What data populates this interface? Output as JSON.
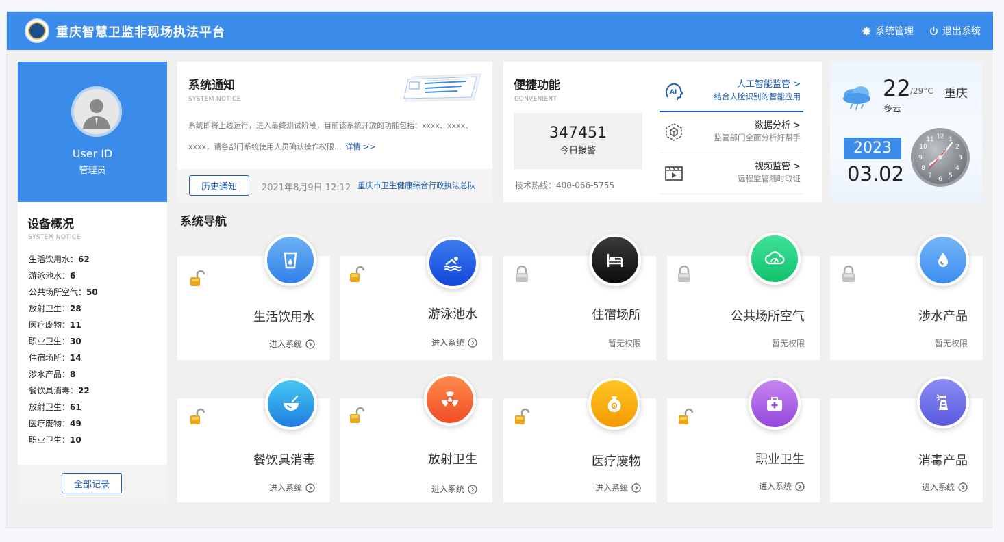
{
  "header": {
    "title": "重庆智慧卫监非现场执法平台",
    "settings_label": "系统管理",
    "logout_label": "退出系统"
  },
  "user": {
    "id": "User ID",
    "role": "管理员"
  },
  "devices": {
    "title": "设备概况",
    "subtitle": "SYSTEM NOTICE",
    "items": [
      {
        "label": "生活饮用水：",
        "value": "62"
      },
      {
        "label": "游泳池水：",
        "value": "6"
      },
      {
        "label": "公共场所空气：",
        "value": "50"
      },
      {
        "label": "放射卫生：",
        "value": "28"
      },
      {
        "label": "医疗废物：",
        "value": "11"
      },
      {
        "label": "职业卫生：",
        "value": "30"
      },
      {
        "label": "住宿场所：",
        "value": "14"
      },
      {
        "label": "涉水产品：",
        "value": "8"
      },
      {
        "label": "餐饮具消毒：",
        "value": "22"
      },
      {
        "label": "放射卫生：",
        "value": "61"
      },
      {
        "label": "医疗废物：",
        "value": "49"
      },
      {
        "label": "职业卫生：",
        "value": "10"
      }
    ],
    "all_records_label": "全部记录"
  },
  "notice": {
    "title": "系统通知",
    "subtitle": "SYSTEM NOTICE",
    "text": "系统即将上线运行，进入最终测试阶段，目前该系统开放的功能包括：xxxx、xxxx、xxxx，请各部门系统使用人员确认操作权限...",
    "more_label": "详情 >>",
    "history_label": "历史通知",
    "date": "2021年8月9日  12:12",
    "org": "重庆市卫生健康综合行政执法总队"
  },
  "quick": {
    "title": "便捷功能",
    "subtitle": "CONVENIENT",
    "alarm_count": "347451",
    "alarm_label": "今日报警",
    "hotline": "技术热线：400-066-5755",
    "items": [
      {
        "name": "人工智能监管 >",
        "desc": "结合人脸识别的智能应用",
        "icon": "ai-head-icon"
      },
      {
        "name": "数据分析 >",
        "desc": "监管部门全面分析好帮手",
        "icon": "data-cube-icon"
      },
      {
        "name": "视频监管 >",
        "desc": "远程监管随时取证",
        "icon": "video-icon"
      }
    ]
  },
  "weather": {
    "temp": "22",
    "range": "/29°C",
    "city": "重庆",
    "condition": "多云",
    "year": "2023",
    "month_day": "03.02",
    "icon": "cloud-rain-icon"
  },
  "nav": {
    "title": "系统导航",
    "cards": [
      {
        "name": "生活饮用水",
        "entry": "进入系统",
        "access": true,
        "color_a": "#6db2f5",
        "color_b": "#2f80e7",
        "icon": "water-cup-icon"
      },
      {
        "name": "游泳池水",
        "entry": "进入系统",
        "access": true,
        "color_a": "#3d7cf0",
        "color_b": "#1146d8",
        "icon": "swimmer-icon"
      },
      {
        "name": "住宿场所",
        "entry": "暂无权限",
        "access": false,
        "color_a": "#3a3a3a",
        "color_b": "#0d0d0d",
        "icon": "bed-icon"
      },
      {
        "name": "公共场所空气",
        "entry": "暂无权限",
        "access": false,
        "color_a": "#3fe29a",
        "color_b": "#11c26d",
        "icon": "air-gauge-icon"
      },
      {
        "name": "涉水产品",
        "entry": "暂无权限",
        "access": false,
        "color_a": "#74b6f8",
        "color_b": "#3d8def",
        "icon": "water-drop-icon"
      },
      {
        "name": "餐饮具消毒",
        "entry": "进入系统",
        "access": true,
        "color_a": "#45c7f0",
        "color_b": "#1e7de3",
        "icon": "bowl-icon"
      },
      {
        "name": "放射卫生",
        "entry": "进入系统",
        "access": true,
        "color_a": "#ff8a4d",
        "color_b": "#f04d24",
        "icon": "radiation-icon"
      },
      {
        "name": "医疗废物",
        "entry": "进入系统",
        "access": true,
        "color_a": "#ffc524",
        "color_b": "#f49a00",
        "icon": "biohazard-bag-icon"
      },
      {
        "name": "职业卫生",
        "entry": "进入系统",
        "access": true,
        "color_a": "#c685f0",
        "color_b": "#9446dc",
        "icon": "medkit-icon"
      },
      {
        "name": "消毒产品",
        "entry": "进入系统",
        "access": true,
        "color_a": "#8c8cf5",
        "color_b": "#5a5adf",
        "icon": "spray-bottle-icon"
      }
    ]
  }
}
